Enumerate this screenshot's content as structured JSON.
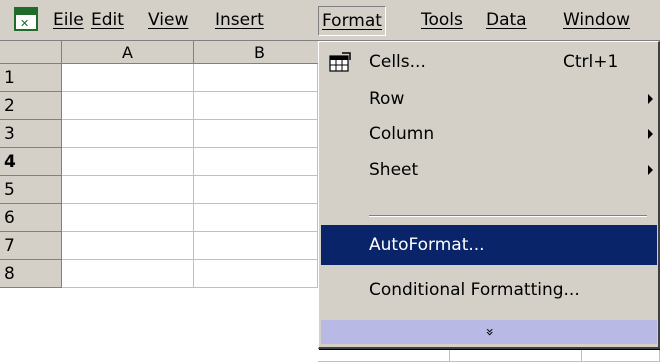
{
  "menubar": {
    "app_icon": "excel-sheet-icon",
    "items": [
      {
        "label": "Eile"
      },
      {
        "label": "Edit"
      },
      {
        "label": "View"
      },
      {
        "label": "Insert"
      },
      {
        "label": "Format"
      },
      {
        "label": "Tools"
      },
      {
        "label": "Data"
      },
      {
        "label": "Window"
      }
    ]
  },
  "sheet": {
    "columns": [
      "A",
      "B"
    ],
    "rows": [
      "1",
      "2",
      "3",
      "4",
      "5",
      "6",
      "7",
      "8"
    ]
  },
  "format_menu": {
    "items": [
      {
        "label": "Cells...",
        "shortcut": "Ctrl+1",
        "icon": "cells-format-icon"
      },
      {
        "label": "Row",
        "submenu": true
      },
      {
        "label": "Column",
        "submenu": true
      },
      {
        "label": "Sheet",
        "submenu": true
      },
      {
        "label": "AutoFormat...",
        "highlighted": true
      },
      {
        "label": "Conditional Formatting..."
      }
    ],
    "expand_glyph": "»",
    "expand_icon": "expand-chevrons-icon",
    "highlight_color": "#0a246a",
    "expand_bar_color": "#b9b9e6"
  }
}
